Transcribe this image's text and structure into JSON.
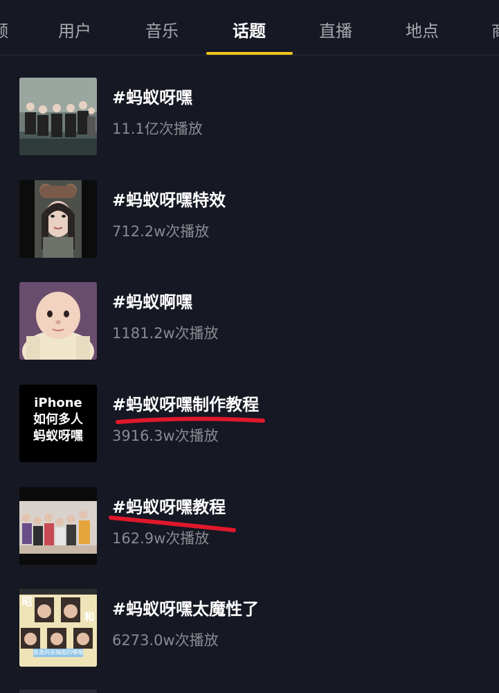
{
  "tabs": [
    {
      "label": "频"
    },
    {
      "label": "用户"
    },
    {
      "label": "音乐"
    },
    {
      "label": "话题"
    },
    {
      "label": "直播"
    },
    {
      "label": "地点"
    },
    {
      "label": "商"
    }
  ],
  "active_tab": "话题",
  "topics": [
    {
      "title": "#蚂蚁呀嘿",
      "plays": "11.1亿次播放"
    },
    {
      "title": "#蚂蚁呀嘿特效",
      "plays": "712.2w次播放"
    },
    {
      "title": "#蚂蚁啊嘿",
      "plays": "1181.2w次播放"
    },
    {
      "title": "#蚂蚁呀嘿制作教程",
      "plays": "3916.3w次播放",
      "thumb_text": [
        "iPhone",
        "如何多人",
        "蚂蚁呀嘿"
      ],
      "highlighted": true
    },
    {
      "title": "#蚂蚁呀嘿教程",
      "plays": "162.9w次播放",
      "highlighted": true
    },
    {
      "title": "#蚂蚁呀嘿太魔性了",
      "plays": "6273.0w次播放",
      "thumb_text": [
        "昭",
        "和",
        "各类同恶搞图的嘿嘿"
      ]
    }
  ],
  "colors": {
    "background": "#161823",
    "active_indicator": "#f5c518",
    "highlight_stroke": "#e0182c",
    "secondary_text": "#8a8b91"
  }
}
